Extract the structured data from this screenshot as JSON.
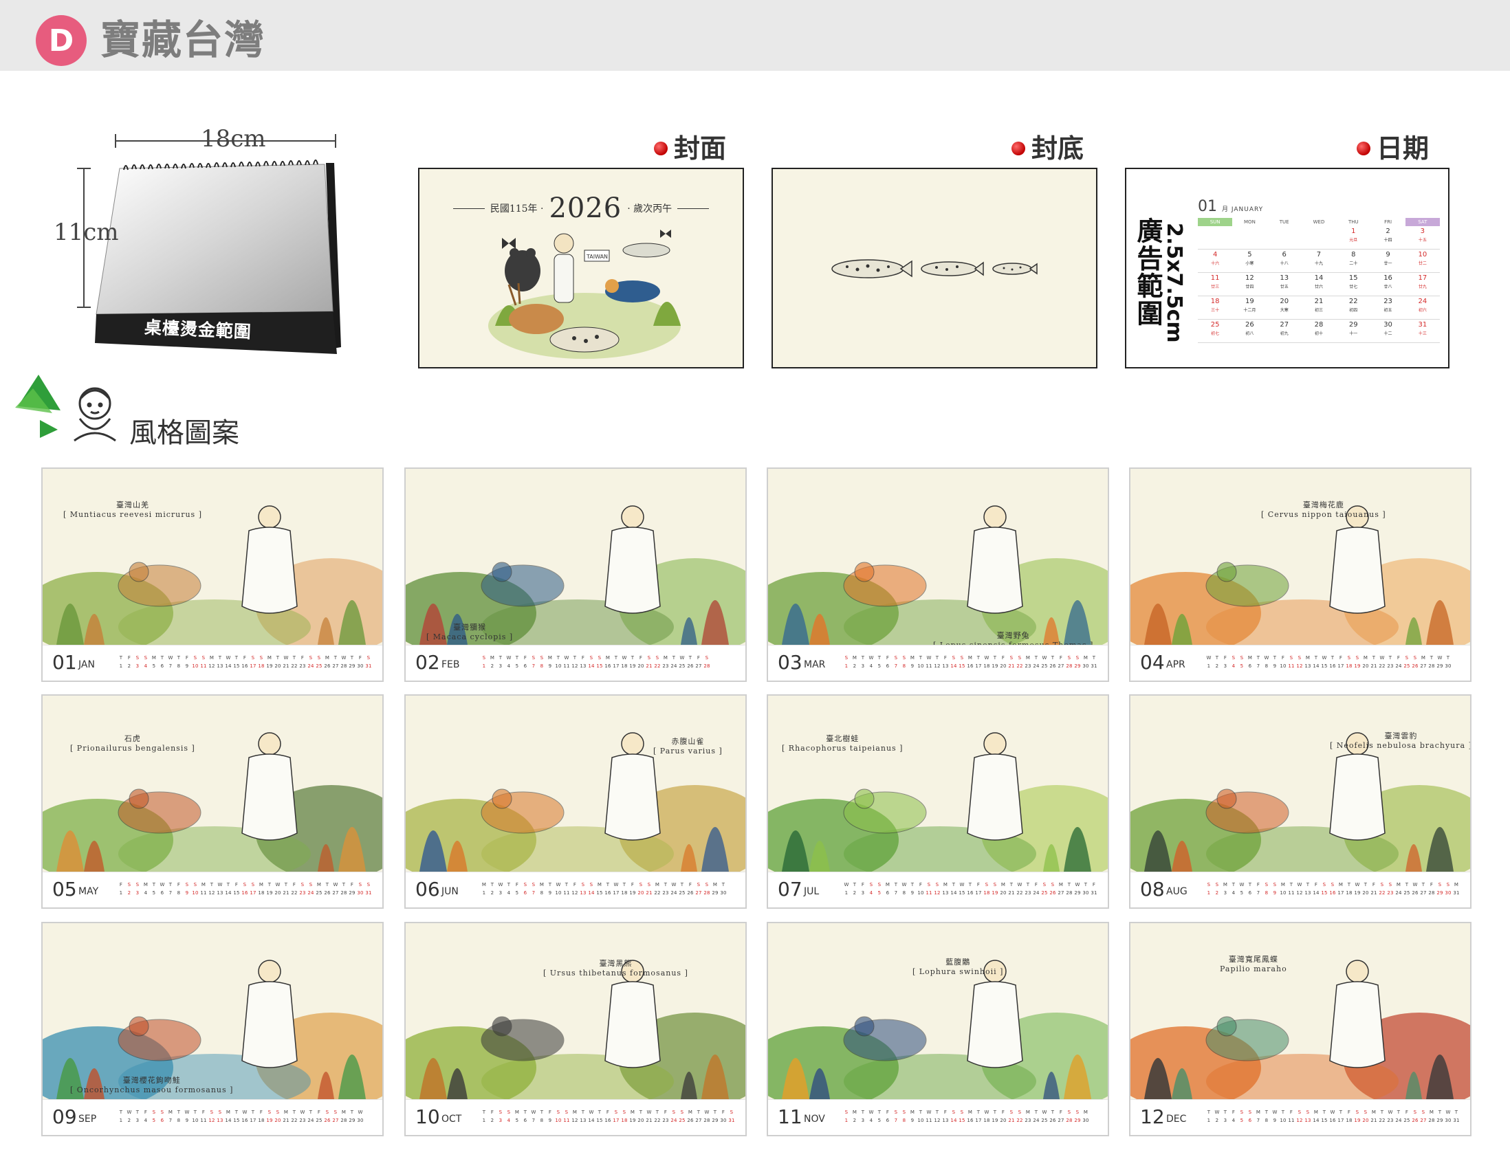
{
  "header": {
    "badge": "D",
    "title": "寶藏台灣"
  },
  "desk_calendar": {
    "width_label": "18cm",
    "height_label": "11cm",
    "base_label": "桌檯燙金範圍"
  },
  "previews": {
    "cover": {
      "label": "封面",
      "left_text": "民國115年 ·",
      "year": "2026",
      "right_text": "· 歲次丙午",
      "sign_text": "TAIWAN"
    },
    "back": {
      "label": "封底"
    },
    "date": {
      "label": "日期",
      "ad_area": "廣告範圍",
      "ad_size": "2.5x7.5cm",
      "month_num": "01",
      "month_name": "月 JANUARY",
      "weekdays": [
        "SUN",
        "MON",
        "TUE",
        "WED",
        "THU",
        "FRI",
        "SAT"
      ],
      "days": [
        {
          "n": "",
          "l": ""
        },
        {
          "n": "",
          "l": ""
        },
        {
          "n": "",
          "l": ""
        },
        {
          "n": "",
          "l": ""
        },
        {
          "n": "1",
          "l": "元旦",
          "red": true
        },
        {
          "n": "2",
          "l": "十四"
        },
        {
          "n": "3",
          "l": "十五",
          "red": true
        },
        {
          "n": "4",
          "l": "十六",
          "red": true
        },
        {
          "n": "5",
          "l": "小寒"
        },
        {
          "n": "6",
          "l": "十八"
        },
        {
          "n": "7",
          "l": "十九"
        },
        {
          "n": "8",
          "l": "二十"
        },
        {
          "n": "9",
          "l": "廿一"
        },
        {
          "n": "10",
          "l": "廿二",
          "red": true
        },
        {
          "n": "11",
          "l": "廿三",
          "red": true
        },
        {
          "n": "12",
          "l": "廿四"
        },
        {
          "n": "13",
          "l": "廿五"
        },
        {
          "n": "14",
          "l": "廿六"
        },
        {
          "n": "15",
          "l": "廿七"
        },
        {
          "n": "16",
          "l": "廿八"
        },
        {
          "n": "17",
          "l": "廿九",
          "red": true
        },
        {
          "n": "18",
          "l": "三十",
          "red": true
        },
        {
          "n": "19",
          "l": "十二月"
        },
        {
          "n": "20",
          "l": "大寒"
        },
        {
          "n": "21",
          "l": "初三"
        },
        {
          "n": "22",
          "l": "初四"
        },
        {
          "n": "23",
          "l": "初五"
        },
        {
          "n": "24",
          "l": "初六",
          "red": true
        },
        {
          "n": "25",
          "l": "初七",
          "red": true
        },
        {
          "n": "26",
          "l": "初八"
        },
        {
          "n": "27",
          "l": "初九"
        },
        {
          "n": "28",
          "l": "初十"
        },
        {
          "n": "29",
          "l": "十一"
        },
        {
          "n": "30",
          "l": "十二"
        },
        {
          "n": "31",
          "l": "十三",
          "red": true
        }
      ]
    }
  },
  "style_section": {
    "label": "風格圖案"
  },
  "months": [
    {
      "num": "01",
      "abbr": "JAN",
      "first": 4,
      "days": 31,
      "sci_zh": "臺灣山羌",
      "sci": "[ Muntiacus reevesi micrurus ]",
      "palette": [
        "#8fb04a",
        "#c5803a",
        "#6f9a3e",
        "#e6b17a"
      ]
    },
    {
      "num": "02",
      "abbr": "FEB",
      "first": 0,
      "days": 28,
      "sci_zh": "臺灣獼猴",
      "sci": "[ Macaca cyclopis ]",
      "palette": [
        "#5f8f3a",
        "#2f5d87",
        "#b04a3a",
        "#9bc06a"
      ]
    },
    {
      "num": "03",
      "abbr": "MAR",
      "first": 0,
      "days": 31,
      "sci_zh": "臺灣野兔",
      "sci": "[ Lepus sinensis formosus Thomas ]",
      "palette": [
        "#6fa23d",
        "#e2752a",
        "#3b6f8f",
        "#a9c96a"
      ]
    },
    {
      "num": "04",
      "abbr": "APR",
      "first": 3,
      "days": 30,
      "sci_zh": "臺灣梅花鹿",
      "sci": "[ Cervus nippon taiouanus ]",
      "palette": [
        "#e48a3a",
        "#6ea23a",
        "#c96a2a",
        "#f0b878"
      ]
    },
    {
      "num": "05",
      "abbr": "MAY",
      "first": 5,
      "days": 31,
      "sci_zh": "石虎",
      "sci": "[ Prionailurus bengalensis ]",
      "palette": [
        "#7fb04a",
        "#c25a2a",
        "#d9913a",
        "#5a7a3a"
      ]
    },
    {
      "num": "06",
      "abbr": "JUN",
      "first": 1,
      "days": 30,
      "sci_zh": "赤腹山雀",
      "sci": "[ Parus varius ]",
      "palette": [
        "#a9b54a",
        "#d8782a",
        "#3b5f8f",
        "#c9a64a"
      ]
    },
    {
      "num": "07",
      "abbr": "JUL",
      "first": 3,
      "days": 31,
      "sci_zh": "臺北樹蛙",
      "sci": "[ Rhacophorus taipeianus ]",
      "palette": [
        "#5fa23a",
        "#8cc04a",
        "#2f6f3a",
        "#b8d06a"
      ]
    },
    {
      "num": "08",
      "abbr": "AUG",
      "first": 6,
      "days": 31,
      "sci_zh": "臺灣雲豹",
      "sci": "[ Neofelis nebulosa brachyura ]",
      "palette": [
        "#6fa23a",
        "#d0612a",
        "#3a4a3a",
        "#a8c05a"
      ]
    },
    {
      "num": "09",
      "abbr": "SEP",
      "first": 2,
      "days": 30,
      "sci_zh": "臺灣櫻花鉤吻鮭",
      "sci": "[ Oncorhynchus masou formosanus ]",
      "palette": [
        "#3a8fb0",
        "#c0502a",
        "#4a9a4a",
        "#e0a04a"
      ]
    },
    {
      "num": "10",
      "abbr": "OCT",
      "first": 4,
      "days": 31,
      "sci_zh": "臺灣黑熊",
      "sci": "[ Ursus thibetanus formosanus ]",
      "palette": [
        "#8fb03a",
        "#3a3a3a",
        "#c0772a",
        "#6f8f3a"
      ]
    },
    {
      "num": "11",
      "abbr": "NOV",
      "first": 0,
      "days": 30,
      "sci_zh": "藍腹鷴",
      "sci": "[ Lophura swinhoii ]",
      "palette": [
        "#5fa23a",
        "#2f4f7f",
        "#e0a02a",
        "#8cc06a"
      ]
    },
    {
      "num": "12",
      "abbr": "DEC",
      "first": 2,
      "days": 31,
      "sci_zh": "臺灣寬尾鳳蝶",
      "sci": "Papilio maraho",
      "palette": [
        "#e0702a",
        "#4a8f6a",
        "#3a3a3a",
        "#c0402a"
      ]
    }
  ]
}
